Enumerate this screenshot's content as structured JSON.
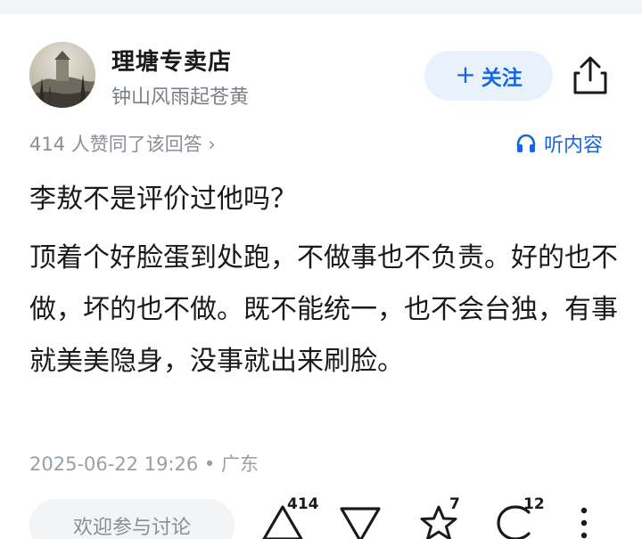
{
  "author": {
    "name": "理塘专卖店",
    "bio": "钟山风雨起苍黄"
  },
  "follow_button": {
    "plus": "+",
    "label": "关注"
  },
  "likes_line": "414 人赞同了该回答 ›",
  "listen_label": "听内容",
  "content": {
    "first_paragraph": "李敖不是评价过他吗？",
    "second_paragraph": "顶着个好脸蛋到处跑，不做事也不负责。好的也不做，坏的也不做。既不能统一，也不会台独，有事就美美隐身，没事就出来刷脸。"
  },
  "meta": "2025-06-22 19:26 • 广东",
  "discuss_placeholder": "欢迎参与讨论",
  "actions": {
    "upvote_count": "414",
    "favorite_count": "7",
    "comment_count": "12"
  },
  "icons": [
    "share-icon",
    "headphones-icon",
    "upvote-icon",
    "downvote-icon",
    "star-icon",
    "comment-icon",
    "more-icon"
  ],
  "colors": {
    "accent": "#1766e0",
    "follow_bg": "#e9f1fd",
    "muted": "#8a8e95"
  }
}
